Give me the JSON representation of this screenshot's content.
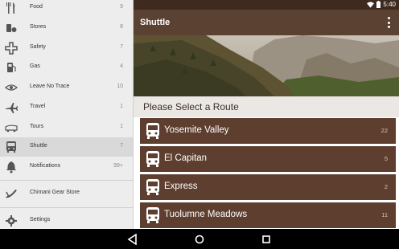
{
  "status_bar": {
    "time": "5:40",
    "wifi_icon": "wifi-icon",
    "battery_icon": "battery-icon"
  },
  "toolbar": {
    "title": "Shuttle",
    "overflow_icon": "more-vert-icon"
  },
  "main": {
    "subtitle": "Please Select a Route"
  },
  "routes": [
    {
      "name": "Yosemite Valley",
      "count": "22",
      "icon": "bus-icon"
    },
    {
      "name": "El Capitan",
      "count": "5",
      "icon": "bus-icon"
    },
    {
      "name": "Express",
      "count": "2",
      "icon": "bus-icon"
    },
    {
      "name": "Tuolumne Meadows",
      "count": "11",
      "icon": "bus-icon"
    }
  ],
  "drawer": {
    "items": [
      {
        "label": "Food",
        "count": "9",
        "icon": "fork-knife-icon"
      },
      {
        "label": "Stores",
        "count": "8",
        "icon": "shopping-icon"
      },
      {
        "label": "Safety",
        "count": "7",
        "icon": "safety-cross-icon"
      },
      {
        "label": "Gas",
        "count": "4",
        "icon": "gas-pump-icon"
      },
      {
        "label": "Leave No Trace",
        "count": "10",
        "icon": "eye-icon"
      },
      {
        "label": "Travel",
        "count": "1",
        "icon": "airplane-icon"
      },
      {
        "label": "Tours",
        "count": "1",
        "icon": "tour-bus-icon"
      },
      {
        "label": "Shuttle",
        "count": "7",
        "icon": "bus-icon",
        "active": true
      },
      {
        "label": "Notifications",
        "count": "99+",
        "icon": "bell-icon"
      },
      {
        "label": "Chimani Gear Store",
        "count": "",
        "icon": "gear-store-icon"
      },
      {
        "label": "Settings",
        "count": "",
        "icon": "settings-gear-icon"
      }
    ]
  },
  "system_nav": {
    "back_icon": "back-triangle-icon",
    "home_icon": "home-circle-icon",
    "recents_icon": "recents-square-icon"
  },
  "colors": {
    "toolbar": "#5b4132",
    "status_bar": "#3e2a1f",
    "route_row": "#5e3e2e",
    "drawer_bg": "#ededed",
    "drawer_active": "#d9d9d9"
  }
}
